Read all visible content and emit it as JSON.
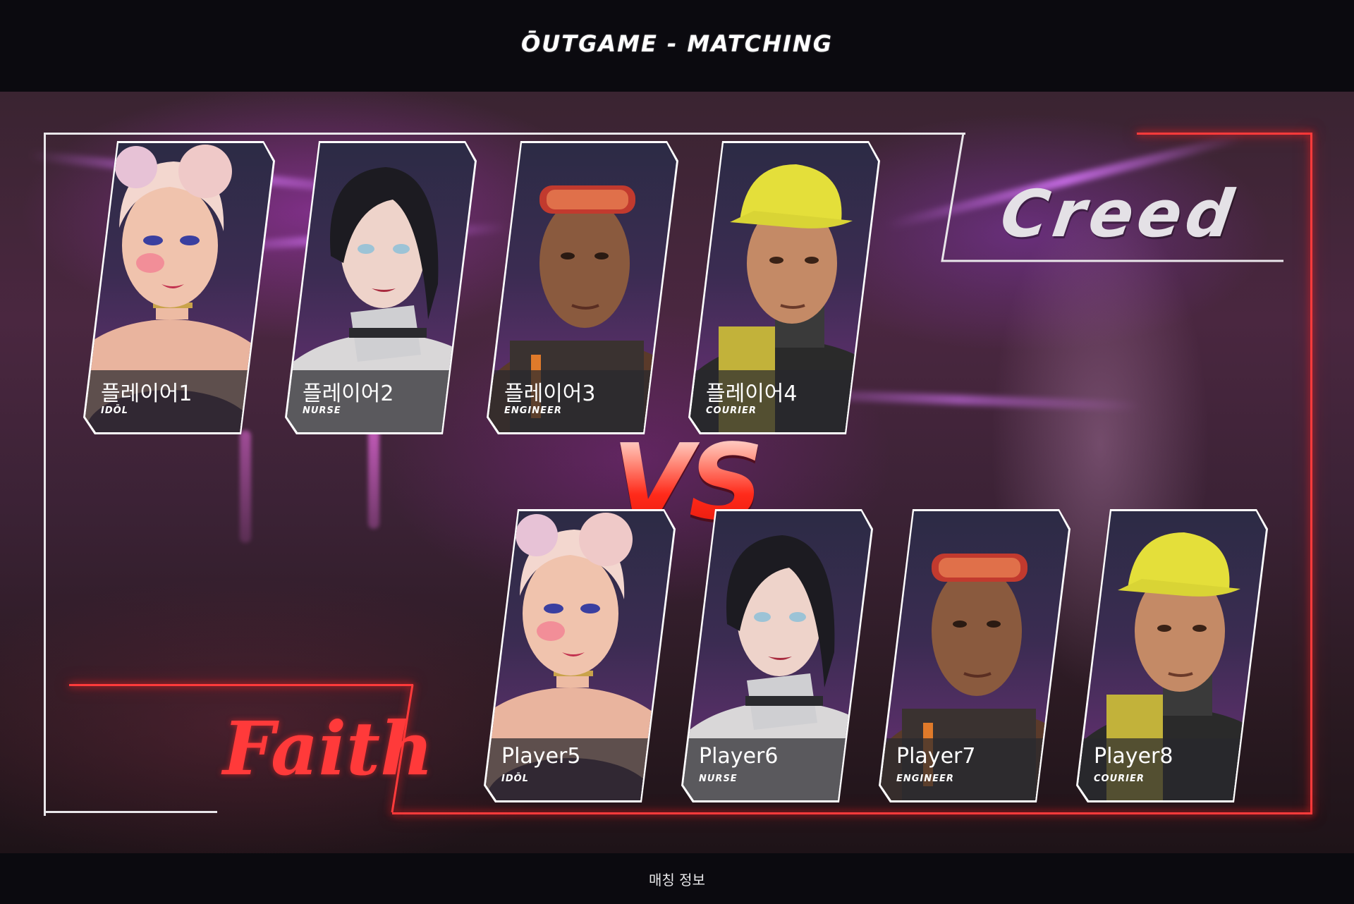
{
  "header": {
    "title": "ŌUTGAME - MATCHING"
  },
  "footer": {
    "label": "매칭 정보"
  },
  "versus": "VS",
  "teams": {
    "top": {
      "name": "Creed"
    },
    "bottom": {
      "name": "Faith"
    }
  },
  "colors": {
    "accent_red": "#ff3b3b",
    "frame_white": "#e9e6ea",
    "background": "#0b0a0f"
  },
  "players_top": [
    {
      "name": "플레이어1",
      "class": "IDŌL",
      "portrait": "idol-portrait"
    },
    {
      "name": "플레이어2",
      "class": "NURSE",
      "portrait": "nurse-portrait"
    },
    {
      "name": "플레이어3",
      "class": "ENGINEER",
      "portrait": "engineer-portrait"
    },
    {
      "name": "플레이어4",
      "class": "COURIER",
      "portrait": "courier-portrait"
    }
  ],
  "players_bottom": [
    {
      "name": "Player5",
      "class": "IDŌL",
      "portrait": "idol-portrait"
    },
    {
      "name": "Player6",
      "class": "NURSE",
      "portrait": "nurse-portrait"
    },
    {
      "name": "Player7",
      "class": "ENGINEER",
      "portrait": "engineer-portrait"
    },
    {
      "name": "Player8",
      "class": "COURIER",
      "portrait": "courier-portrait"
    }
  ]
}
